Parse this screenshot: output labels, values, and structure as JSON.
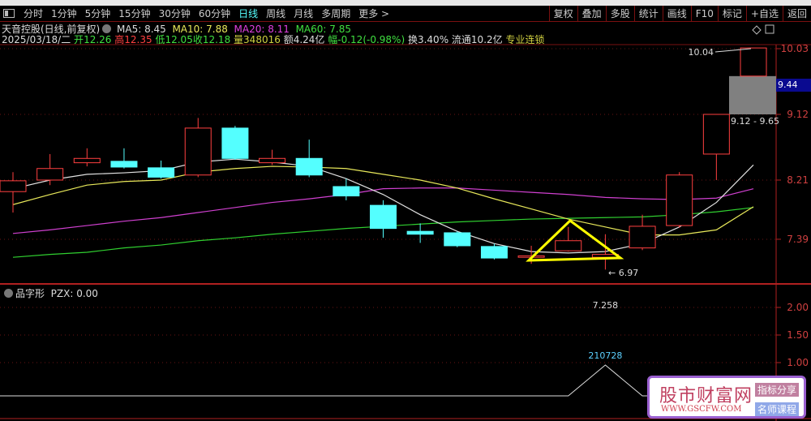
{
  "toolbar": {
    "periods": [
      "分时",
      "1分钟",
      "5分钟",
      "15分钟",
      "30分钟",
      "60分钟",
      "日线",
      "周线",
      "月线",
      "多周期",
      "更多 >"
    ],
    "active": "日线",
    "right": [
      "复权",
      "叠加",
      "多股",
      "统计",
      "画线",
      "F10",
      "标记",
      "+自选",
      "返回"
    ]
  },
  "info": {
    "name": "天音控股(日线,前复权)",
    "ma5": "MA5: 8.45",
    "ma10": "MA10: 7.88",
    "ma20": "MA20: 8.11",
    "ma60": "MA60: 7.85",
    "date": "2025/03/18/二",
    "open_l": "开",
    "open": "12.26",
    "high_l": "高",
    "high": "12.35",
    "low_l": "低",
    "low": "12.05",
    "close_l": "收",
    "close": "12.18",
    "vol_l": "量",
    "vol": "348016",
    "amt": "额4.24亿",
    "chg_l": "幅",
    "chg": "-0.12(-0.98%)",
    "turn": "换3.40%",
    "float": "流通10.2亿",
    "tag": "专业连锁"
  },
  "axis": {
    "labels": [
      "10.03",
      "9.12",
      "8.21",
      "7.39"
    ],
    "current": "9.44"
  },
  "annotations": {
    "high": "10.04",
    "low": "6.97",
    "range": "9.12 - 9.65"
  },
  "colors": {
    "up": "#ff4040",
    "down": "#54ffff",
    "ma5": "#e0e0e0",
    "ma10": "#e8e85a",
    "ma20": "#d040d0",
    "ma60": "#30d030",
    "triangle": "#ffff00"
  },
  "candles": [
    [
      8.05,
      8.2,
      8.32,
      7.76
    ],
    [
      8.21,
      8.37,
      8.57,
      8.14
    ],
    [
      8.45,
      8.51,
      8.65,
      8.4
    ],
    [
      8.47,
      8.39,
      8.65,
      8.37
    ],
    [
      8.38,
      8.25,
      8.48,
      8.23
    ],
    [
      8.28,
      8.93,
      9.07,
      8.25
    ],
    [
      8.93,
      8.51,
      8.96,
      8.49
    ],
    [
      8.45,
      8.51,
      8.63,
      8.42
    ],
    [
      8.51,
      8.28,
      8.77,
      8.25
    ],
    [
      8.12,
      7.99,
      8.23,
      7.93
    ],
    [
      7.86,
      7.54,
      7.93,
      7.41
    ],
    [
      7.5,
      7.46,
      7.61,
      7.34
    ],
    [
      7.48,
      7.3,
      7.5,
      7.28
    ],
    [
      7.29,
      7.13,
      7.33,
      7.11
    ],
    [
      7.14,
      7.16,
      7.3,
      7.05
    ],
    [
      7.23,
      7.37,
      7.56,
      7.22
    ],
    [
      7.14,
      7.18,
      7.46,
      6.97
    ],
    [
      7.27,
      7.57,
      7.73,
      7.24
    ],
    [
      7.58,
      8.28,
      8.32,
      7.55
    ],
    [
      8.57,
      9.12,
      9.12,
      8.21
    ],
    [
      9.65,
      10.04,
      10.04,
      9.65
    ]
  ],
  "ma5": [
    8.09,
    8.21,
    8.29,
    8.31,
    8.34,
    8.46,
    8.5,
    8.46,
    8.4,
    8.23,
    8.01,
    7.73,
    7.5,
    7.33,
    7.22,
    7.2,
    7.22,
    7.33,
    7.56,
    7.9,
    8.42
  ],
  "ma10": [
    7.87,
    8.01,
    8.14,
    8.19,
    8.21,
    8.32,
    8.37,
    8.4,
    8.39,
    8.37,
    8.29,
    8.21,
    8.1,
    7.95,
    7.81,
    7.67,
    7.56,
    7.45,
    7.45,
    7.52,
    7.84
  ],
  "ma20": [
    7.47,
    7.52,
    7.58,
    7.64,
    7.69,
    7.76,
    7.83,
    7.9,
    7.95,
    8.01,
    8.09,
    8.1,
    8.1,
    8.07,
    8.04,
    8.01,
    7.97,
    7.95,
    7.94,
    7.96,
    8.09
  ],
  "ma60": [
    7.14,
    7.18,
    7.21,
    7.27,
    7.31,
    7.37,
    7.41,
    7.46,
    7.5,
    7.54,
    7.57,
    7.6,
    7.63,
    7.65,
    7.67,
    7.68,
    7.69,
    7.7,
    7.73,
    7.77,
    7.83
  ],
  "lower": {
    "name": "品字形",
    "value": "PZX: 0.00",
    "axis": [
      "2.00",
      "1.50",
      "1.00"
    ],
    "peak_label1": "7.258",
    "peak_label2": "210728",
    "series": [
      0,
      0,
      0,
      0,
      0,
      0,
      0,
      0,
      0,
      0,
      0,
      0,
      0,
      0,
      0,
      0,
      1,
      0,
      0,
      0,
      0
    ]
  },
  "watermark": {
    "title": "股市财富网",
    "url": "WWW.GSCFW.COM",
    "b1": "指标分享",
    "b2": "名师课程"
  }
}
